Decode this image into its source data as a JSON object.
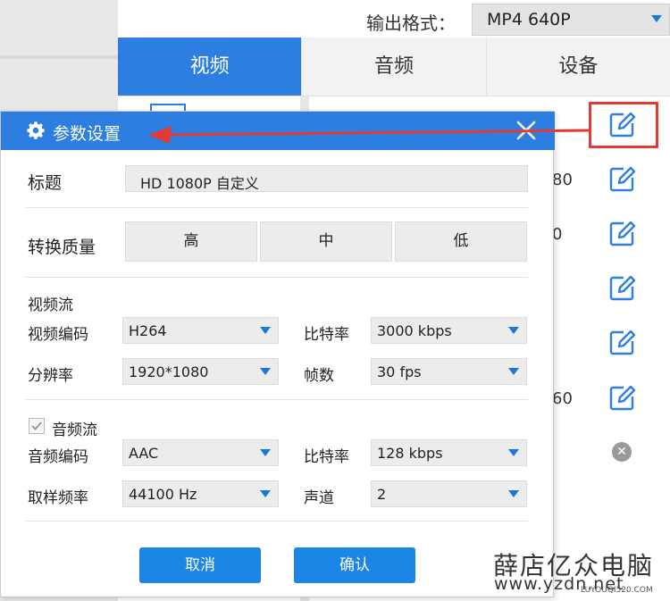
{
  "header": {
    "format_label": "输出格式：",
    "format_value": "MP4  640P"
  },
  "tabs": [
    {
      "label": "视频",
      "active": true
    },
    {
      "label": "音频",
      "active": false
    },
    {
      "label": "设备",
      "active": false
    }
  ],
  "background_rows": [
    {
      "text": "80"
    },
    {
      "text": "0"
    },
    {
      "text": "60"
    }
  ],
  "icons": {
    "edit": "edit-icon",
    "remove": "remove-icon",
    "gear": "gear-icon",
    "close": "close-icon",
    "dropdown": "dropdown-arrow-icon",
    "check": "check-icon"
  },
  "colors": {
    "accent": "#2c7fe0",
    "button": "#1b86e6",
    "highlight": "#e53935"
  },
  "dialog": {
    "title": "参数设置",
    "title_label": "标题",
    "title_value": "HD 1080P 自定义",
    "quality_label": "转换质量",
    "quality_options": [
      "高",
      "中",
      "低"
    ],
    "video_section": "视频流",
    "video_codec_label": "视频编码",
    "video_codec_value": "H264",
    "video_bitrate_label": "比特率",
    "video_bitrate_value": "3000 kbps",
    "resolution_label": "分辨率",
    "resolution_value": "1920*1080",
    "fps_label": "帧数",
    "fps_value": "30 fps",
    "audio_section": "音频流",
    "audio_enabled": true,
    "audio_codec_label": "音频编码",
    "audio_codec_value": "AAC",
    "audio_bitrate_label": "比特率",
    "audio_bitrate_value": "128 kbps",
    "sample_rate_label": "取样频率",
    "sample_rate_value": "44100 Hz",
    "channels_label": "声道",
    "channels_value": "2",
    "cancel_label": "取消",
    "confirm_label": "确认"
  },
  "watermark": {
    "line1": "薛店亿众电脑",
    "line2": "www.yzdn.net",
    "line3": "LUYOUQI520.COM"
  }
}
